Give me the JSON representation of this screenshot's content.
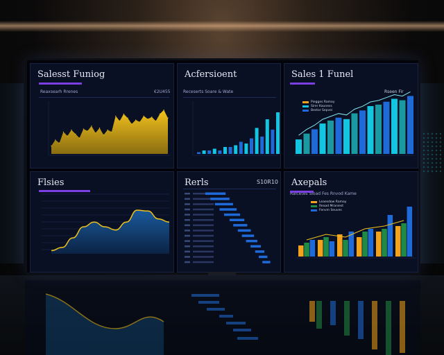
{
  "panels": {
    "top_left": {
      "title": "Salesst Funiog",
      "subtitle": "Reaxsearh Rrenes",
      "right_label": "€2U455"
    },
    "top_middle": {
      "title": "Acfersioent",
      "subtitle": "Receserts Soare & Wate"
    },
    "top_right": {
      "title": "Sales 1 Funel",
      "right_label": "Rseen Fir",
      "legend": [
        "Piegges Ramay",
        "Sirer Kauness",
        "Bestor Sepvei"
      ]
    },
    "bottom_left": {
      "title": "Flsies"
    },
    "bottom_middle": {
      "title": "Rerls",
      "right_label": "S10R10"
    },
    "bottom_right": {
      "title": "Axepals",
      "subtitle": "Raicetes Sioad Fes Rnvod Kame",
      "legend": [
        "Leaesdow Ramay",
        "Reaad Mraniest",
        "Fenvm Seuves"
      ]
    }
  },
  "colors": {
    "accent": "#7b3fe4",
    "gold": "#f2c21c",
    "cyan": "#12c5e0",
    "blue": "#1e6ad8",
    "green": "#1f8a46",
    "orange": "#f2a21c",
    "teal": "#1a9aa0"
  },
  "chart_data": [
    {
      "type": "area",
      "title": "Salesst Funiog",
      "values": [
        8,
        14,
        11,
        22,
        18,
        24,
        20,
        16,
        25,
        23,
        28,
        21,
        26,
        19,
        24,
        22,
        38,
        33,
        40,
        36,
        30,
        34,
        32,
        38,
        35,
        37,
        33,
        40,
        44,
        36
      ],
      "ylim": [
        0,
        50
      ]
    },
    {
      "type": "bar",
      "title": "Acfersioent",
      "values": [
        1,
        2,
        2,
        3,
        2,
        4,
        4,
        5,
        7,
        6,
        9,
        15,
        10,
        20,
        14,
        24
      ],
      "ylim": [
        0,
        28
      ]
    },
    {
      "type": "bar",
      "title": "Sales 1 Funel",
      "values": [
        10,
        14,
        17,
        21,
        23,
        25,
        24,
        28,
        30,
        33,
        34,
        36,
        38,
        37,
        40
      ],
      "ylim": [
        0,
        44
      ]
    },
    {
      "type": "area",
      "title": "Flsies",
      "values": [
        4,
        8,
        20,
        34,
        40,
        34,
        30,
        40,
        55,
        54,
        44,
        40
      ],
      "ylim": [
        0,
        70
      ]
    },
    {
      "type": "bar",
      "title": "Rerls",
      "values": [
        95,
        88,
        82,
        76,
        70,
        62,
        58,
        52,
        47,
        42,
        36,
        30,
        26,
        22
      ],
      "ylim": [
        0,
        100
      ]
    },
    {
      "type": "bar",
      "title": "Axepals",
      "series": [
        {
          "name": "Leaesdow Ramay",
          "values": [
            8,
            12,
            16,
            14,
            18,
            22
          ]
        },
        {
          "name": "Reaad Mraniest",
          "values": [
            10,
            14,
            12,
            18,
            20,
            24
          ]
        },
        {
          "name": "Fenvm Seuves",
          "values": [
            12,
            11,
            18,
            20,
            30,
            36
          ]
        }
      ],
      "ylim": [
        0,
        40
      ]
    }
  ]
}
